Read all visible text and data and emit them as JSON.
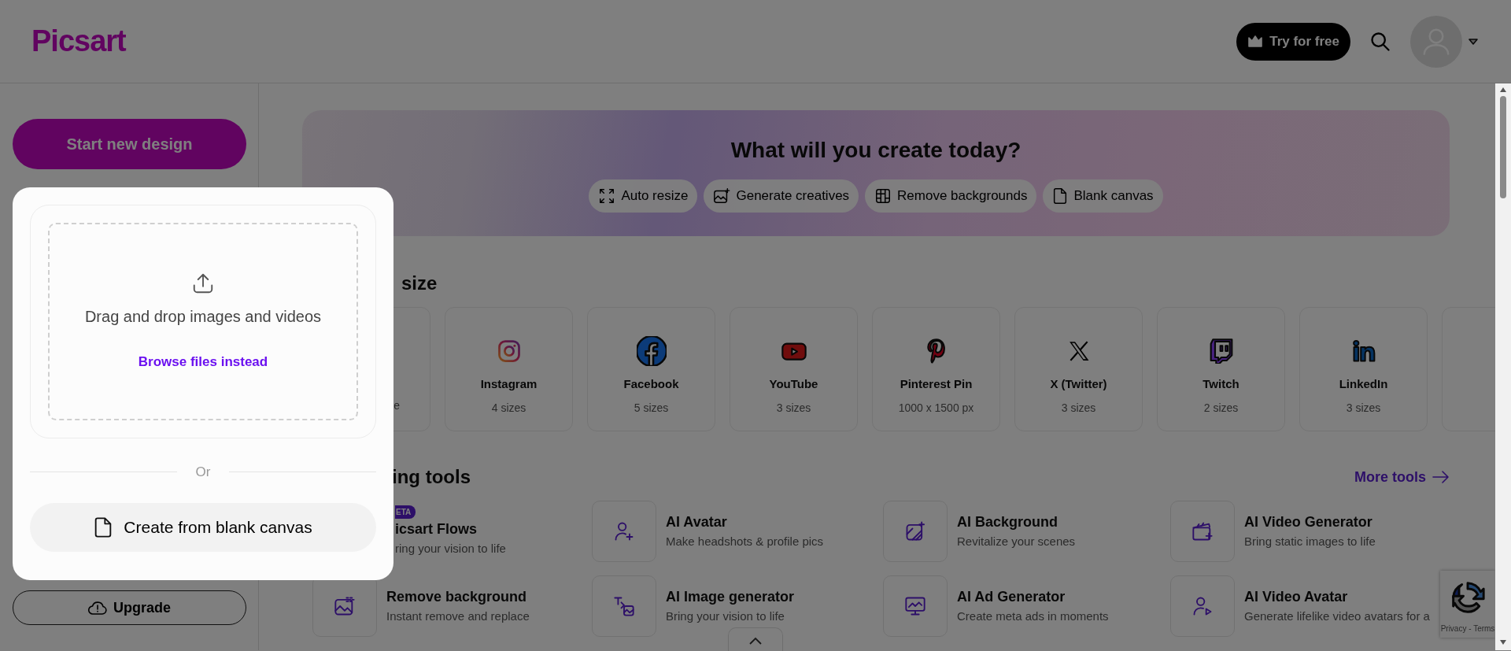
{
  "header": {
    "logo": "Picsart",
    "try_button": "Try for free"
  },
  "sidebar": {
    "start_button": "Start new design",
    "upgrade_button": "Upgrade"
  },
  "banner": {
    "title": "What will you create today?",
    "chips": [
      {
        "label": "Auto resize",
        "kind": "resize"
      },
      {
        "label": "Generate creatives",
        "kind": "generate"
      },
      {
        "label": "Remove backgrounds",
        "kind": "remove"
      },
      {
        "label": "Blank canvas",
        "kind": "blank"
      }
    ]
  },
  "sizes": {
    "heading": "size",
    "cards": [
      {
        "kind": "partial",
        "sub": "e"
      },
      {
        "kind": "instagram",
        "name": "Instagram",
        "sub": "4 sizes"
      },
      {
        "kind": "facebook",
        "name": "Facebook",
        "sub": "5 sizes"
      },
      {
        "kind": "youtube",
        "name": "YouTube",
        "sub": "3 sizes"
      },
      {
        "kind": "pinterest",
        "name": "Pinterest Pin",
        "sub": "1000 x 1500 px"
      },
      {
        "kind": "x",
        "name": "X (Twitter)",
        "sub": "3 sizes"
      },
      {
        "kind": "twitch",
        "name": "Twitch",
        "sub": "2 sizes"
      },
      {
        "kind": "linkedin",
        "name": "LinkedIn",
        "sub": "3 sizes"
      },
      {
        "kind": "blank"
      }
    ]
  },
  "tools": {
    "heading": "ing tools",
    "more_link": "More tools",
    "items": [
      {
        "kind": "partial",
        "badge": "ETA",
        "title": "icsart Flows",
        "desc": "ring your vision to life"
      },
      {
        "kind": "avatar",
        "title": "AI Avatar",
        "desc": "Make headshots & profile pics"
      },
      {
        "kind": "background",
        "title": "AI Background",
        "desc": "Revitalize your scenes"
      },
      {
        "kind": "video",
        "title": "AI Video Generator",
        "desc": "Bring static images to life"
      },
      {
        "kind": "remove",
        "title": "Remove background",
        "desc": "Instant remove and replace"
      },
      {
        "kind": "imagegen",
        "title": "AI Image generator",
        "desc": "Bring your vision to life"
      },
      {
        "kind": "ad",
        "title": "AI Ad Generator",
        "desc": "Create meta ads in moments"
      },
      {
        "kind": "videoavatar",
        "title": "AI Video Avatar",
        "desc": "Generate lifelike video avatars for a"
      }
    ]
  },
  "modal": {
    "drop_text": "Drag and drop images and videos",
    "browse_link": "Browse files instead",
    "divider": "Or",
    "blank_button": "Create from blank canvas"
  },
  "recaptcha": {
    "text": "Privacy - Terms"
  }
}
